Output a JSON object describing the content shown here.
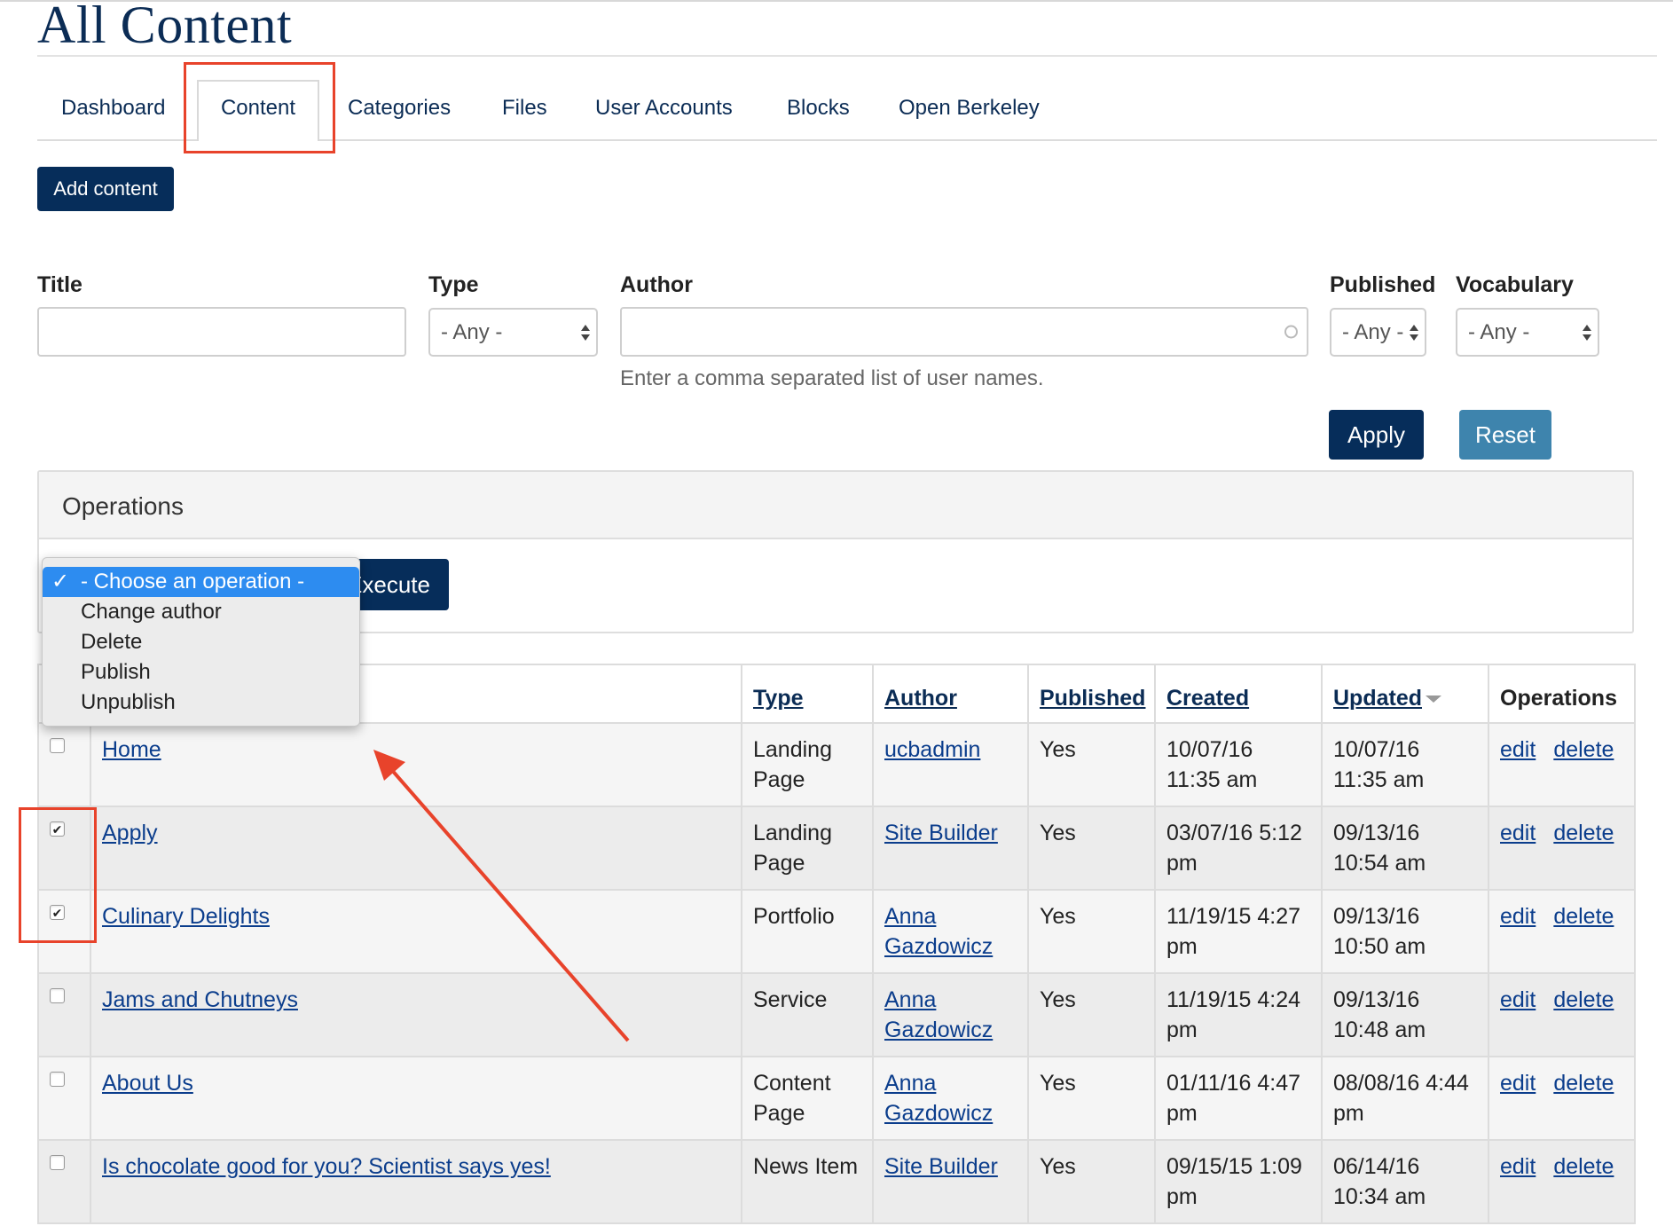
{
  "page": {
    "title": "All Content"
  },
  "tabs": [
    {
      "label": "Dashboard"
    },
    {
      "label": "Content"
    },
    {
      "label": "Categories"
    },
    {
      "label": "Files"
    },
    {
      "label": "User Accounts"
    },
    {
      "label": "Blocks"
    },
    {
      "label": "Open Berkeley"
    }
  ],
  "actions": {
    "add_content": "Add content"
  },
  "filters": {
    "title": {
      "label": "Title",
      "value": ""
    },
    "type": {
      "label": "Type",
      "value": "- Any -"
    },
    "author": {
      "label": "Author",
      "value": "",
      "help": "Enter a comma separated list of user names."
    },
    "published": {
      "label": "Published",
      "value": "- Any -"
    },
    "vocabulary": {
      "label": "Vocabulary",
      "value": "- Any -"
    },
    "apply": "Apply",
    "reset": "Reset"
  },
  "operations": {
    "title": "Operations",
    "execute": "Execute",
    "options": [
      "- Choose an operation -",
      "Change author",
      "Delete",
      "Publish",
      "Unpublish"
    ],
    "selected": "- Choose an operation -"
  },
  "table": {
    "headers": {
      "type": "Type",
      "author": "Author",
      "published": "Published",
      "created": "Created",
      "updated": "Updated",
      "operations": "Operations"
    },
    "rows": [
      {
        "title": "Home",
        "type": "Landing Page",
        "author": "ucbadmin",
        "published": "Yes",
        "created": "10/07/16 11:35 am",
        "updated": "10/07/16 11:35 am",
        "edit": "edit",
        "delete": "delete",
        "checked": false
      },
      {
        "title": "Apply",
        "type": "Landing Page",
        "author": "Site Builder",
        "published": "Yes",
        "created": "03/07/16 5:12 pm",
        "updated": "09/13/16 10:54 am",
        "edit": "edit",
        "delete": "delete",
        "checked": true
      },
      {
        "title": "Culinary Delights",
        "type": "Portfolio",
        "author": "Anna Gazdowicz",
        "published": "Yes",
        "created": "11/19/15 4:27 pm",
        "updated": "09/13/16 10:50 am",
        "edit": "edit",
        "delete": "delete",
        "checked": true
      },
      {
        "title": "Jams and Chutneys",
        "type": "Service",
        "author": "Anna Gazdowicz",
        "published": "Yes",
        "created": "11/19/15 4:24 pm",
        "updated": "09/13/16 10:48 am",
        "edit": "edit",
        "delete": "delete",
        "checked": false
      },
      {
        "title": "About Us",
        "type": "Content Page",
        "author": "Anna Gazdowicz",
        "published": "Yes",
        "created": "01/11/16 4:47 pm",
        "updated": "08/08/16 4:44 pm",
        "edit": "edit",
        "delete": "delete",
        "checked": false
      },
      {
        "title": "Is chocolate good for you? Scientist says yes!",
        "type": "News Item",
        "author": "Site Builder",
        "published": "Yes",
        "created": "09/15/15 1:09 pm",
        "updated": "06/14/16 10:34 am",
        "edit": "edit",
        "delete": "delete",
        "checked": false
      }
    ]
  },
  "annotation": {
    "color": "#e8432b"
  },
  "colors": {
    "brand_navy": "#062d5a",
    "reset_blue": "#3e84ad",
    "selected_option": "#2d8cf0"
  }
}
